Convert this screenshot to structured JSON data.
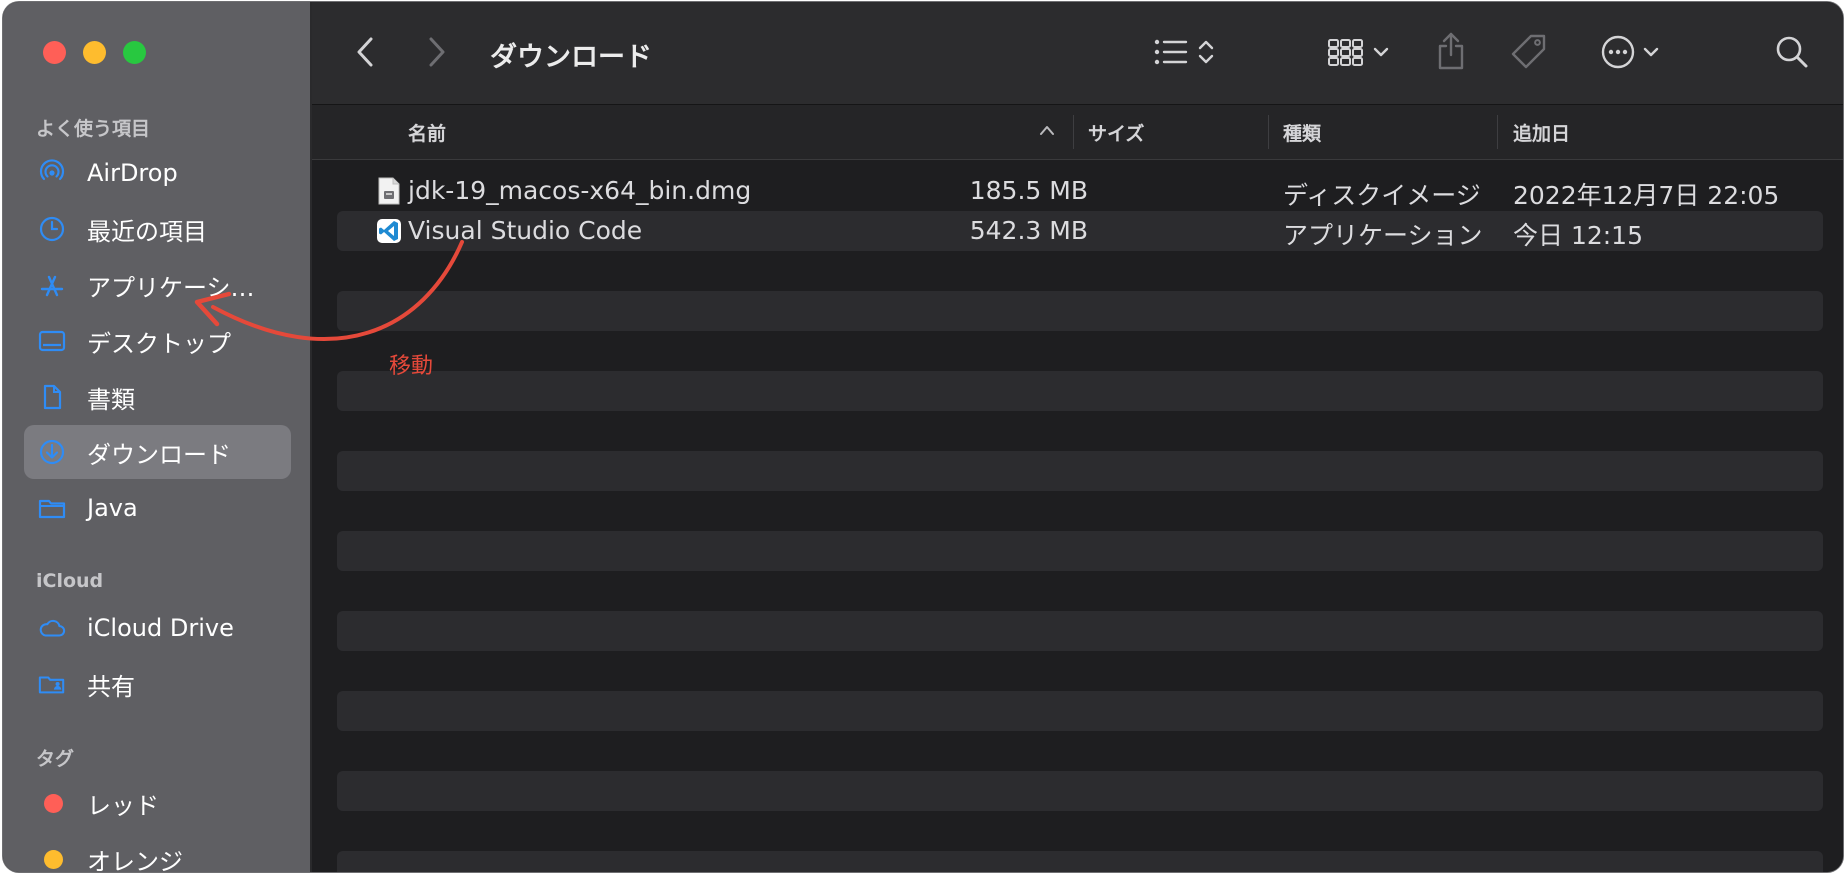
{
  "window": {
    "title": "ダウンロード",
    "accent_color": "#2f8cf5"
  },
  "sidebar": {
    "sections": [
      {
        "title": "よく使う項目",
        "items": [
          {
            "label": "AirDrop",
            "icon": "airdrop-icon"
          },
          {
            "label": "最近の項目",
            "icon": "clock-icon"
          },
          {
            "label": "アプリケーシ…",
            "icon": "applications-icon"
          },
          {
            "label": "デスクトップ",
            "icon": "desktop-icon"
          },
          {
            "label": "書類",
            "icon": "document-icon"
          },
          {
            "label": "ダウンロード",
            "icon": "download-icon",
            "selected": true
          },
          {
            "label": "Java",
            "icon": "folder-icon"
          }
        ]
      },
      {
        "title": "iCloud",
        "items": [
          {
            "label": "iCloud Drive",
            "icon": "cloud-icon"
          },
          {
            "label": "共有",
            "icon": "shared-folder-icon"
          }
        ]
      },
      {
        "title": "タグ",
        "items": [
          {
            "label": "レッド",
            "color": "#ff5f57"
          },
          {
            "label": "オレンジ",
            "color": "#febc2e"
          }
        ]
      }
    ]
  },
  "columns": {
    "name": "名前",
    "size": "サイズ",
    "kind": "種類",
    "date_added": "追加日"
  },
  "files": [
    {
      "name": "jdk-19_macos-x64_bin.dmg",
      "size": "185.5 MB",
      "kind": "ディスクイメージ",
      "date_added": "2022年12月7日 22:05",
      "icon": "disk-image-icon"
    },
    {
      "name": "Visual Studio Code",
      "size": "542.3 MB",
      "kind": "アプリケーション",
      "date_added": "今日 12:15",
      "icon": "vscode-icon"
    }
  ],
  "annotation": {
    "label": "移動",
    "color": "#e5493a"
  }
}
